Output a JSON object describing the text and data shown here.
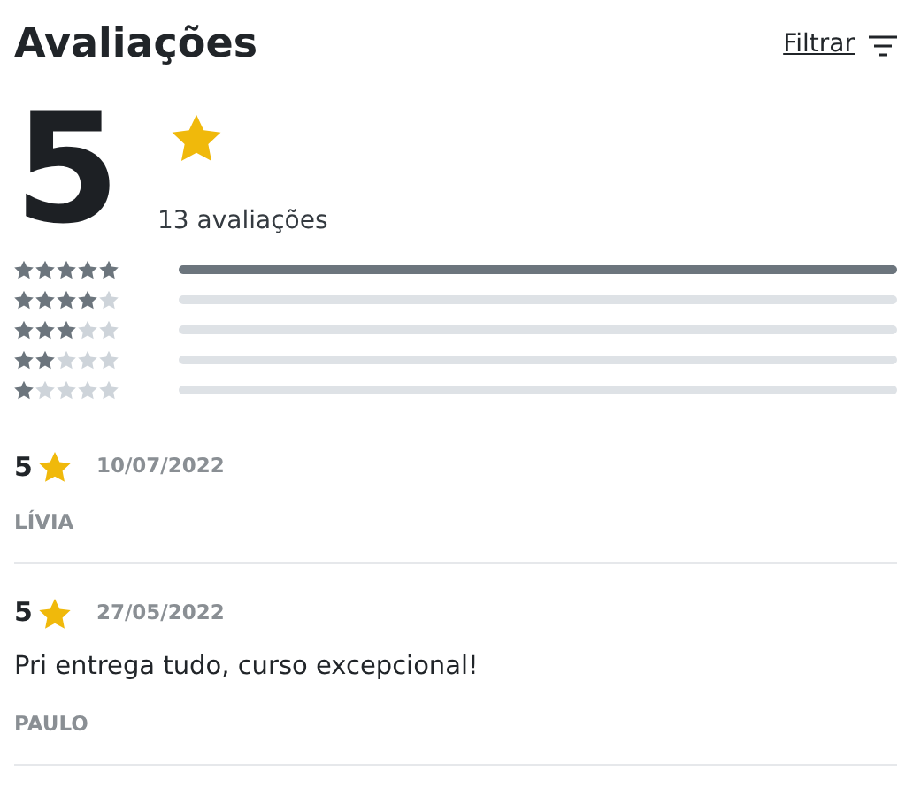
{
  "title": "Avaliações",
  "filter": {
    "label": "Filtrar"
  },
  "summary": {
    "average": "5",
    "count": "13 avaliações"
  },
  "breakdown": [
    {
      "stars": 5,
      "level": 1
    },
    {
      "stars": 4,
      "level": 0
    },
    {
      "stars": 3,
      "level": 0
    },
    {
      "stars": 2,
      "level": 0
    },
    {
      "stars": 1,
      "level": 0
    }
  ],
  "reviews": [
    {
      "rating": "5",
      "date": "10/07/2022",
      "author": "LÍVIA"
    },
    {
      "rating": "5",
      "date": "27/05/2022",
      "text": "Pri entrega tudo, curso excepcional!",
      "author": "PAULO"
    }
  ]
}
